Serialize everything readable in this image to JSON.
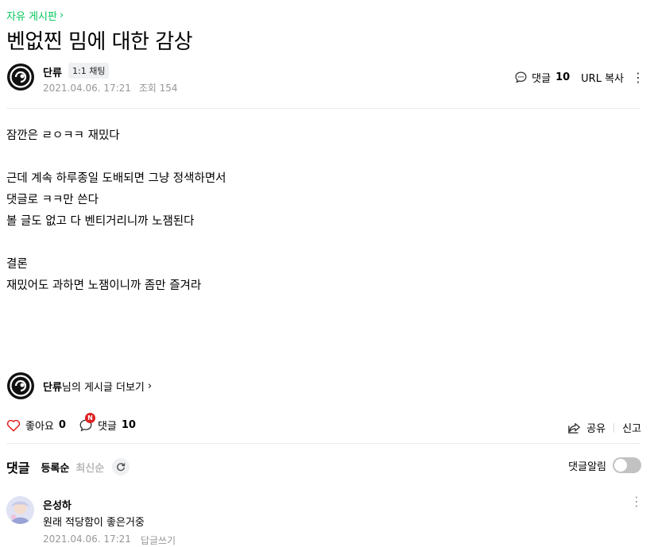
{
  "board": {
    "label": "자유 게시판"
  },
  "article": {
    "title": "벤없찐 밈에 대한 감상",
    "author": "단류",
    "chat_label": "1:1 채팅",
    "date": "2021.04.06. 17:21",
    "views": "조회 154",
    "comment_label": "댓글",
    "comment_count": "10",
    "url_copy": "URL 복사",
    "body": [
      "잠깐은 ㄹㅇㅋㅋ 재밌다",
      "",
      "근데 계속 하루종일 도배되면 그냥 정색하면서",
      "댓글로 ㅋㅋ만 쓴다",
      "볼 글도 없고 다 벤티거리니까 노잼된다",
      "",
      "결론",
      "재밌어도 과하면 노잼이니까 좀만 즐겨라"
    ]
  },
  "more_posts": {
    "author": "단류",
    "suffix": "님의 게시글 더보기"
  },
  "actions": {
    "like_label": "좋아요",
    "like_count": "0",
    "comment_label": "댓글",
    "comment_count": "10",
    "new_badge": "N",
    "share": "공유",
    "report": "신고"
  },
  "comments": {
    "title": "댓글",
    "sort_registered": "등록순",
    "sort_latest": "최신순",
    "notify_label": "댓글알림",
    "notify_on": false,
    "items": [
      {
        "author": "은성하",
        "text": "원래 적당함이 좋은거중",
        "date": "2021.04.06. 17:21",
        "reply": "답글쓰기"
      }
    ]
  },
  "colors": {
    "accent": "#03c75a",
    "badge": "#e02020",
    "muted": "#979797"
  }
}
